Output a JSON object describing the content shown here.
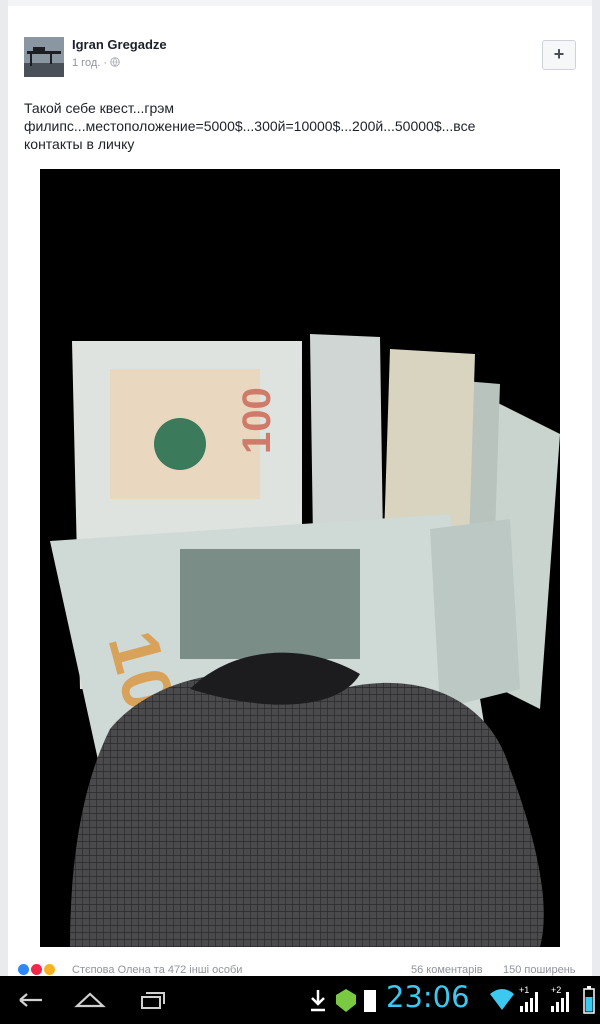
{
  "post": {
    "author": "Igran Gregadze",
    "time": "1 год.",
    "separator": "·",
    "text": "Такой себе квест...грэм филипс...местоположение=5000$...300й=10000$...200й...50000$...все контакты в личку",
    "add_button": "+",
    "avatar_icon": "sniper-rifle-avatar",
    "privacy_icon": "globe-icon"
  },
  "footer": {
    "reactions": [
      "like",
      "love",
      "wow"
    ],
    "reactors": "Стєпова Олена та 472 інші особи",
    "comments": "56 коментарів",
    "shares": "150 поширень"
  },
  "navbar": {
    "buttons": [
      "back",
      "home",
      "recent-apps"
    ]
  },
  "statusbar": {
    "time": "23:06",
    "icons": [
      "download-icon",
      "shield-icon",
      "sd-card-icon",
      "wifi-icon",
      "signal-1-icon",
      "signal-2-icon",
      "battery-icon"
    ],
    "signal_labels": [
      "+1",
      "+2"
    ],
    "accent": "#3cc9ef"
  },
  "colors": {
    "author": "#1d2129",
    "meta": "#90949c",
    "page_bg": "#e9ebee"
  }
}
